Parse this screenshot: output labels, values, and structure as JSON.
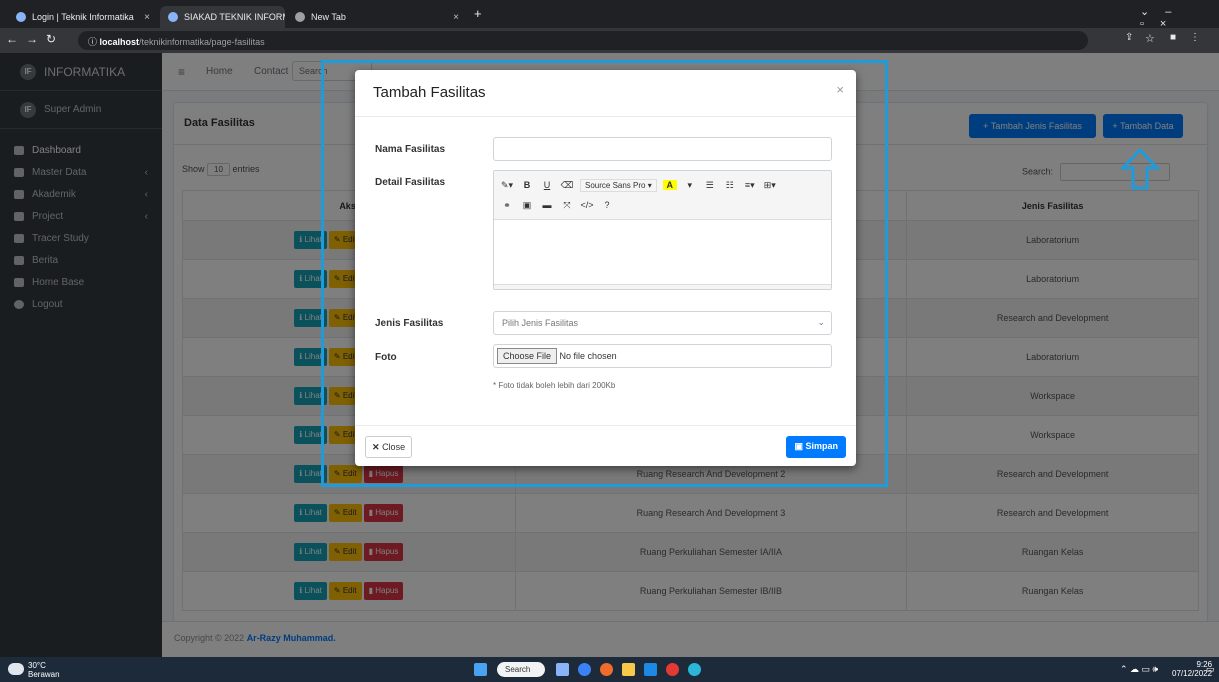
{
  "browser": {
    "tabs": [
      {
        "title": "Login | Teknik Informatika",
        "active": false
      },
      {
        "title": "SIAKAD TEKNIK INFORMATIKA -",
        "active": true
      },
      {
        "title": "New Tab",
        "active": false
      }
    ],
    "url_host": "localhost",
    "url_path": "/teknikinformatika/page-fasilitas"
  },
  "sidebar": {
    "brand": "INFORMATIKA",
    "user": "Super Admin",
    "items": [
      {
        "label": "Dashboard",
        "icon": "dashboard-icon",
        "expandable": false
      },
      {
        "label": "Master Data",
        "icon": "table-icon",
        "expandable": true
      },
      {
        "label": "Akademik",
        "icon": "table-icon",
        "expandable": true
      },
      {
        "label": "Project",
        "icon": "book-icon",
        "expandable": true
      },
      {
        "label": "Tracer Study",
        "icon": "briefcase-icon",
        "expandable": false
      },
      {
        "label": "Berita",
        "icon": "newspaper-icon",
        "expandable": false
      },
      {
        "label": "Home Base",
        "icon": "home-icon",
        "expandable": false
      },
      {
        "label": "Logout",
        "icon": "power-icon",
        "expandable": false
      }
    ]
  },
  "topnav": {
    "home": "Home",
    "contact": "Contact",
    "search_placeholder": "Search"
  },
  "card": {
    "title": "Data Fasilitas",
    "btn_jenis": "Tambah Jenis Fasilitas",
    "btn_tambah": "Tambah Data",
    "show_label": "Show",
    "show_value": "10",
    "entries_label": "entries",
    "search_label": "Search:",
    "columns": {
      "aksi": "Aksi",
      "jenis": "Jenis Fasilitas"
    },
    "action_labels": {
      "lihat": "Lihat",
      "edit": "Edit",
      "hapus": "Hapus"
    },
    "rows": [
      {
        "nama": "",
        "jenis": "Laboratorium"
      },
      {
        "nama": "",
        "jenis": "Laboratorium"
      },
      {
        "nama": "",
        "jenis": "Research and Development"
      },
      {
        "nama": "",
        "jenis": "Laboratorium"
      },
      {
        "nama": "",
        "jenis": "Workspace"
      },
      {
        "nama": "",
        "jenis": "Workspace"
      },
      {
        "nama": "Ruang Research And Development 2",
        "jenis": "Research and Development"
      },
      {
        "nama": "Ruang Research And Development 3",
        "jenis": "Research and Development"
      },
      {
        "nama": "Ruang Perkuliahan Semester IA/IIA",
        "jenis": "Ruangan Kelas"
      },
      {
        "nama": "Ruang Perkuliahan Semester IB/IIB",
        "jenis": "Ruangan Kelas"
      }
    ]
  },
  "footer": {
    "text": "Copyright © 2022",
    "author": "Ar-Razy Muhammad."
  },
  "modal": {
    "title": "Tambah Fasilitas",
    "close_x": "×",
    "nama_label": "Nama Fasilitas",
    "nama_value": "",
    "detail_label": "Detail Fasilitas",
    "editor_font": "Source Sans Pro",
    "jenis_label": "Jenis Fasilitas",
    "jenis_placeholder": "Pilih Jenis Fasilitas",
    "foto_label": "Foto",
    "choose_file": "Choose File",
    "no_file": "No file chosen",
    "help": "* Foto tidak boleh lebih dari 200Kb",
    "btn_close": "Close",
    "btn_save": "Simpan"
  },
  "taskbar": {
    "weather_temp": "30°C",
    "weather_desc": "Berawan",
    "search": "Search",
    "time": "9:26",
    "date": "07/12/2022"
  },
  "colors": {
    "primary": "#007bff",
    "sidebar": "#343a40",
    "highlight": "#1f9bdc"
  }
}
